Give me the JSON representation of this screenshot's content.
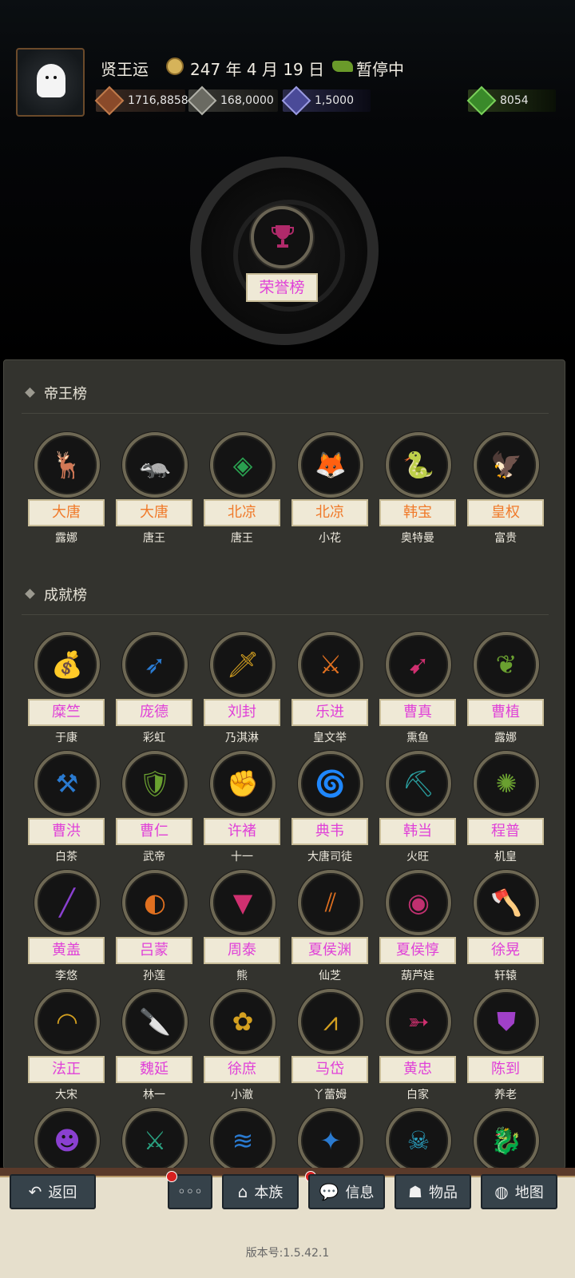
{
  "header": {
    "player_name": "贤王运",
    "date_text": "247 年 4 月 19 日",
    "status": "暂停中",
    "resources": [
      {
        "icon": "gold-icon",
        "value": "1716,8858",
        "color": "#8a4a2a"
      },
      {
        "icon": "grain-icon",
        "value": "168,0000",
        "color": "#7a7a72"
      },
      {
        "icon": "troops-icon",
        "value": "1,5000",
        "color": "#5a5aa8"
      }
    ],
    "special_resource": {
      "icon": "money-bag-icon",
      "value": "8054",
      "color": "#3a8a2a"
    }
  },
  "honor": {
    "label": "荣誉榜",
    "icon": "trophy-icon"
  },
  "emperor_section": {
    "title": "帝王榜",
    "items": [
      {
        "icon": "deer-icon",
        "glyph": "🦌",
        "color": "#8a50c8",
        "name": "大唐",
        "owner": "露娜",
        "name_color": "orange"
      },
      {
        "icon": "badger-icon",
        "glyph": "🦡",
        "color": "#8a50c8",
        "name": "大唐",
        "owner": "唐王",
        "name_color": "orange"
      },
      {
        "icon": "pinecone-icon",
        "glyph": "◈",
        "color": "#2aa050",
        "name": "北凉",
        "owner": "唐王",
        "name_color": "orange"
      },
      {
        "icon": "fox-icon",
        "glyph": "🦊",
        "color": "#2aa050",
        "name": "北凉",
        "owner": "小花",
        "name_color": "orange"
      },
      {
        "icon": "cobra-icon",
        "glyph": "🐍",
        "color": "#e07020",
        "name": "韩宝",
        "owner": "奥特曼",
        "name_color": "orange"
      },
      {
        "icon": "eagle-icon",
        "glyph": "🦅",
        "color": "#d4a020",
        "name": "皇权",
        "owner": "富贵",
        "name_color": "orange"
      }
    ]
  },
  "achievement_section": {
    "title": "成就榜",
    "items": [
      {
        "icon": "coin-bag-icon",
        "glyph": "💰",
        "color": "#d03030",
        "name": "糜竺",
        "owner": "于康"
      },
      {
        "icon": "arrow-icon",
        "glyph": "➶",
        "color": "#2a7ad0",
        "name": "庞德",
        "owner": "彩虹"
      },
      {
        "icon": "dagger-icon",
        "glyph": "🗡",
        "color": "#d4a020",
        "name": "刘封",
        "owner": "乃淇淋"
      },
      {
        "icon": "crossed-swords-icon",
        "glyph": "⚔",
        "color": "#e07020",
        "name": "乐进",
        "owner": "皇文举"
      },
      {
        "icon": "heart-arrow-icon",
        "glyph": "➹",
        "color": "#d03070",
        "name": "曹真",
        "owner": "熏鱼"
      },
      {
        "icon": "twin-swans-icon",
        "glyph": "❦",
        "color": "#6aa030",
        "name": "曹植",
        "owner": "露娜"
      },
      {
        "icon": "sword-stone-icon",
        "glyph": "⚒",
        "color": "#2a7ad0",
        "name": "曹洪",
        "owner": "白茶"
      },
      {
        "icon": "armor-icon",
        "glyph": "🛡",
        "color": "#6aa030",
        "name": "曹仁",
        "owner": "武帝"
      },
      {
        "icon": "gauntlet-icon",
        "glyph": "✊",
        "color": "#a040c8",
        "name": "许褚",
        "owner": "十一"
      },
      {
        "icon": "vortex-icon",
        "glyph": "🌀",
        "color": "#e07020",
        "name": "典韦",
        "owner": "大唐司徒"
      },
      {
        "icon": "shovel-icon",
        "glyph": "⛏",
        "color": "#2aa0a0",
        "name": "韩当",
        "owner": "火旺"
      },
      {
        "icon": "splash-icon",
        "glyph": "✺",
        "color": "#6aa030",
        "name": "程普",
        "owner": "机皇"
      },
      {
        "icon": "staff-icon",
        "glyph": "╱",
        "color": "#8a40d0",
        "name": "黄盖",
        "owner": "李悠"
      },
      {
        "icon": "mask-icon",
        "glyph": "◐",
        "color": "#e07020",
        "name": "吕蒙",
        "owner": "孙莲"
      },
      {
        "icon": "dripping-icon",
        "glyph": "▼",
        "color": "#d03070",
        "name": "周泰",
        "owner": "熊"
      },
      {
        "icon": "claw-slash-icon",
        "glyph": "⫽",
        "color": "#e07020",
        "name": "夏侯渊",
        "owner": "仙芝"
      },
      {
        "icon": "eyeball-icon",
        "glyph": "◉",
        "color": "#c03070",
        "name": "夏侯惇",
        "owner": "葫芦娃"
      },
      {
        "icon": "battle-axe-icon",
        "glyph": "🪓",
        "color": "#e07020",
        "name": "徐晃",
        "owner": "轩辕"
      },
      {
        "icon": "domino-mask-icon",
        "glyph": "◠",
        "color": "#d4a020",
        "name": "法正",
        "owner": "大宋"
      },
      {
        "icon": "bloody-blade-icon",
        "glyph": "🔪",
        "color": "#d03030",
        "name": "魏延",
        "owner": "林一"
      },
      {
        "icon": "leaf-icon",
        "glyph": "✿",
        "color": "#d4a020",
        "name": "徐庶",
        "owner": "小澈"
      },
      {
        "icon": "kunai-icon",
        "glyph": "⩘",
        "color": "#d4a020",
        "name": "马岱",
        "owner": "丫蕾姆"
      },
      {
        "icon": "bow-icon",
        "glyph": "➳",
        "color": "#d03070",
        "name": "黄忠",
        "owner": "白家"
      },
      {
        "icon": "chest-armor-icon",
        "glyph": "⛊",
        "color": "#a040c8",
        "name": "陈到",
        "owner": "养老"
      }
    ],
    "partial_row": [
      {
        "icon": "idea-head-icon",
        "glyph": "☻",
        "color": "#8a40d0"
      },
      {
        "icon": "long-sword-icon",
        "glyph": "⚔",
        "color": "#2aa080"
      },
      {
        "icon": "wave-icon",
        "glyph": "≋",
        "color": "#2a7ad0"
      },
      {
        "icon": "ice-sword-icon",
        "glyph": "✦",
        "color": "#2a7ad0"
      },
      {
        "icon": "skull-icon",
        "glyph": "☠",
        "color": "#2aa0c0"
      },
      {
        "icon": "dragon-icon",
        "glyph": "🐉",
        "color": "#e07020"
      }
    ]
  },
  "bottom_nav": {
    "back": "返回",
    "more": "◦◦◦",
    "clan": "本族",
    "info": "信息",
    "items": "物品",
    "map": "地图"
  },
  "version": "版本号:1.5.42.1"
}
